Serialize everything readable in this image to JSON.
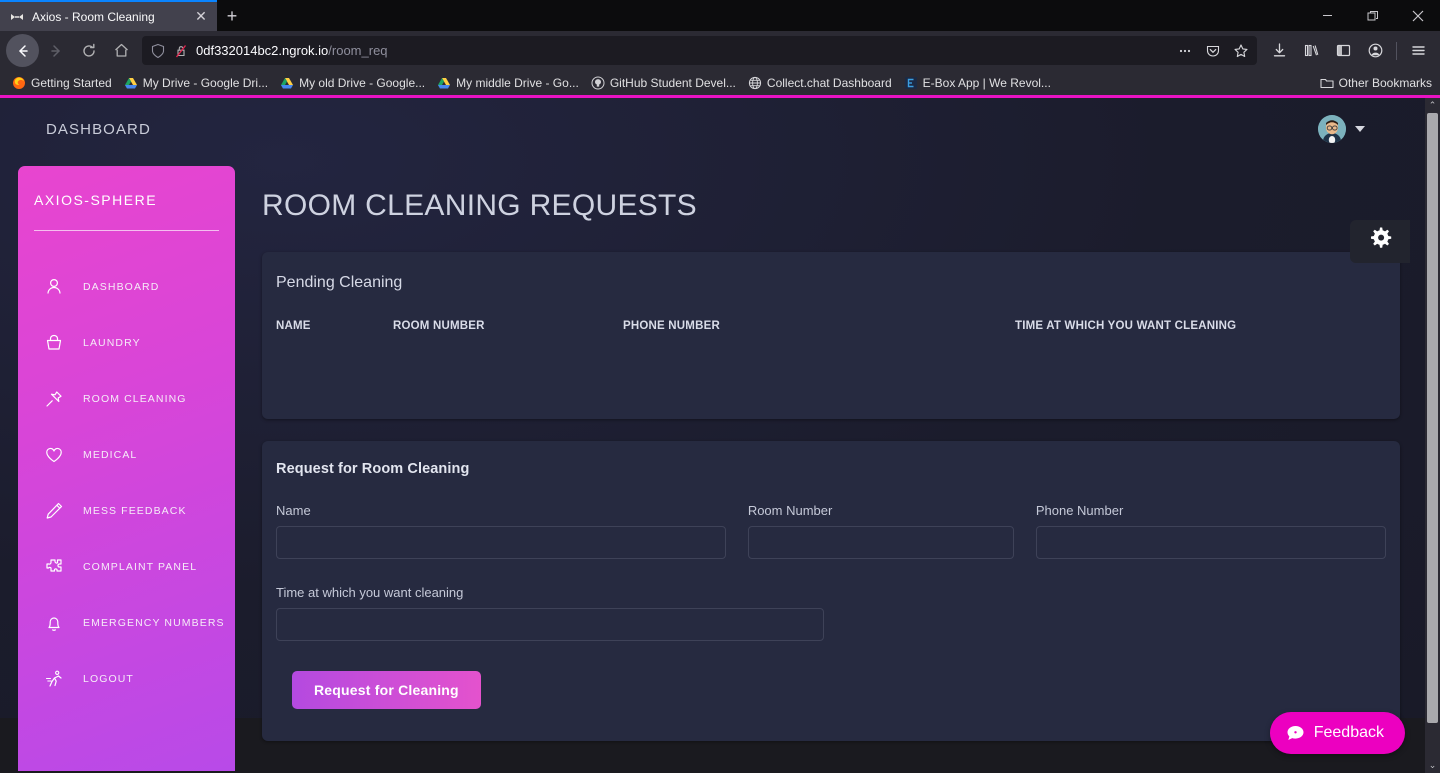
{
  "browser": {
    "tab": {
      "title": "Axios - Room Cleaning",
      "favicon": "axios-favicon",
      "close_label": "✕"
    },
    "newtab_label": "+",
    "window_controls": {
      "minimize": "—",
      "maximize": "❐",
      "close": "✕"
    },
    "nav": {
      "back": "←",
      "forward": "→",
      "reload": "↻",
      "home": "⌂"
    },
    "url": {
      "domain": "0df332014bc2.ngrok.io",
      "path": "/room_req"
    },
    "url_icons": [
      "more-icon",
      "shield-pocket-icon",
      "bookmark-star-icon"
    ],
    "toolbar_icons": [
      "downloads-icon",
      "library-icon",
      "sidebar-icon",
      "account-icon",
      "menu-icon"
    ],
    "bookmarks": [
      {
        "label": "Getting Started",
        "icon": "firefox-icon"
      },
      {
        "label": "My Drive - Google Dri...",
        "icon": "gdrive-icon"
      },
      {
        "label": "My old Drive - Google...",
        "icon": "gdrive-icon"
      },
      {
        "label": "My middle Drive - Go...",
        "icon": "gdrive-icon"
      },
      {
        "label": "GitHub Student Devel...",
        "icon": "github-icon"
      },
      {
        "label": "Collect.chat Dashboard",
        "icon": "globe-icon"
      },
      {
        "label": "E-Box App | We Revol...",
        "icon": "ebox-icon"
      }
    ],
    "other_bookmarks": {
      "label": "Other Bookmarks",
      "icon": "folder-icon"
    }
  },
  "app": {
    "topbar": {
      "title": "DASHBOARD",
      "avatar": "user-avatar",
      "caret": "chevron-down-icon"
    },
    "sidebar": {
      "brand": "AXIOS-SPHERE",
      "items": [
        {
          "label": "DASHBOARD",
          "icon": "user-icon"
        },
        {
          "label": "LAUNDRY",
          "icon": "basket-icon"
        },
        {
          "label": "ROOM CLEANING",
          "icon": "pin-icon"
        },
        {
          "label": "MEDICAL",
          "icon": "heart-icon"
        },
        {
          "label": "MESS FEEDBACK",
          "icon": "pencil-icon"
        },
        {
          "label": "COMPLAINT PANEL",
          "icon": "puzzle-icon"
        },
        {
          "label": "EMERGENCY NUMBERS",
          "icon": "bell-icon"
        },
        {
          "label": "LOGOUT",
          "icon": "running-person-icon"
        }
      ]
    },
    "page_title": "ROOM CLEANING REQUESTS",
    "pending": {
      "heading": "Pending Cleaning",
      "columns": [
        "NAME",
        "ROOM NUMBER",
        "PHONE NUMBER",
        "TIME AT WHICH YOU WANT CLEANING"
      ],
      "rows": []
    },
    "form": {
      "title": "Request for Room Cleaning",
      "fields": [
        {
          "label": "Name",
          "value": "",
          "placeholder": ""
        },
        {
          "label": "Room Number",
          "value": "",
          "placeholder": ""
        },
        {
          "label": "Phone Number",
          "value": "",
          "placeholder": ""
        },
        {
          "label": "Time at which you want cleaning",
          "value": "",
          "placeholder": ""
        }
      ],
      "submit_label": "Request for Cleaning"
    },
    "gear_button": {
      "icon": "gear-icon"
    },
    "feedback": {
      "label": "Feedback",
      "icon": "chat-bubble-icon"
    }
  },
  "colors": {
    "accent_pink": "#e913c4",
    "sidebar_start": "#e845cf",
    "sidebar_end": "#b84ae8",
    "page_bg": "#1f2033",
    "card_bg": "#262a40",
    "button_start": "#b44ae0",
    "button_end": "#e452cd",
    "feedback_bg": "#ec00c0"
  },
  "scrollbar": {
    "up": "⌃",
    "down": "⌄"
  }
}
